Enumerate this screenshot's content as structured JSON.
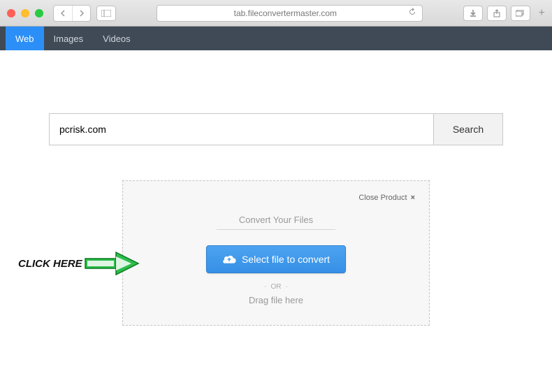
{
  "browser": {
    "url": "tab.fileconvertermaster.com"
  },
  "tabs": [
    {
      "label": "Web",
      "active": true
    },
    {
      "label": "Images",
      "active": false
    },
    {
      "label": "Videos",
      "active": false
    }
  ],
  "search": {
    "value": "pcrisk.com",
    "placeholder": "",
    "button": "Search"
  },
  "converter": {
    "close_label": "Close Product",
    "close_x": "×",
    "title": "Convert Your Files",
    "select_button": "Select file to convert",
    "or_label": "OR",
    "drag_label": "Drag file here"
  },
  "callout": {
    "text": "CLICK HERE"
  },
  "colors": {
    "tab_active_bg": "#2b8ff7",
    "tabs_bg": "#3f4a56",
    "button_blue": "#3d95e8",
    "arrow_green": "#2dbd4a"
  }
}
